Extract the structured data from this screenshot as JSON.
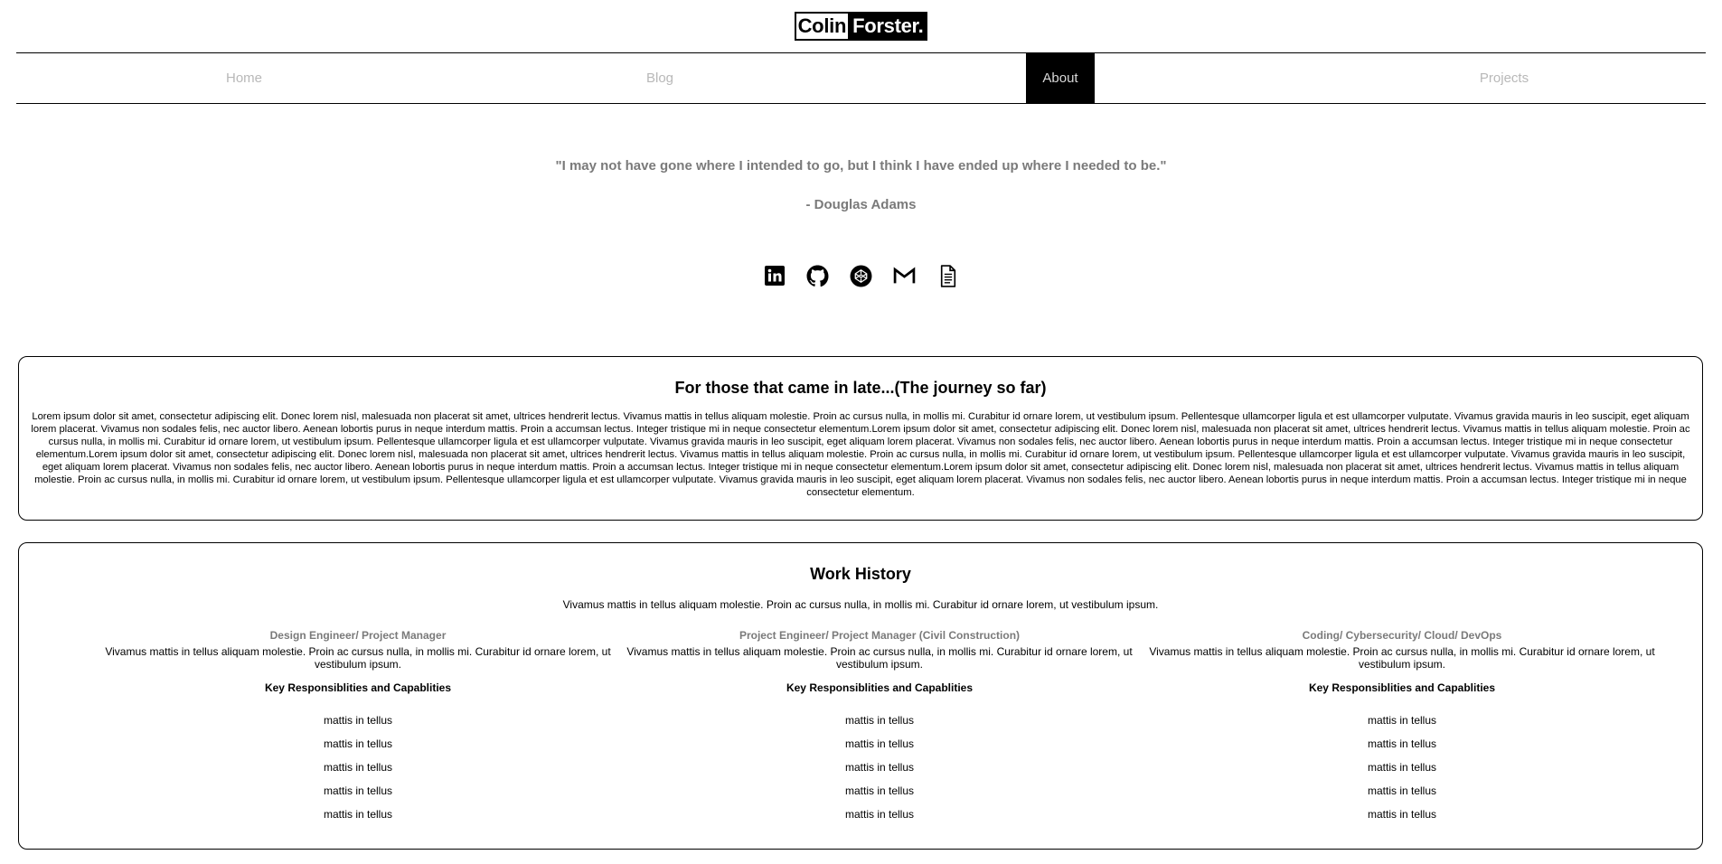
{
  "brand": {
    "first": "Colin",
    "last": "Forster."
  },
  "nav": [
    {
      "label": "Home",
      "active": false
    },
    {
      "label": "Blog",
      "active": false
    },
    {
      "label": "About",
      "active": true
    },
    {
      "label": "Projects",
      "active": false
    }
  ],
  "quote": {
    "text": "\"I may not have gone where I intended to go, but I think I have ended up where I needed to be.\"",
    "author": "- Douglas Adams"
  },
  "socials": [
    "linkedin-icon",
    "github-icon",
    "codepen-icon",
    "gmail-icon",
    "resume-document-icon"
  ],
  "journey": {
    "title": "For those that came in late...(The journey so far)",
    "text": "Lorem ipsum dolor sit amet, consectetur adipiscing elit. Donec lorem nisl, malesuada non placerat sit amet, ultrices hendrerit lectus. Vivamus mattis in tellus aliquam molestie. Proin ac cursus nulla, in mollis mi. Curabitur id ornare lorem, ut vestibulum ipsum. Pellentesque ullamcorper ligula et est ullamcorper vulputate. Vivamus gravida mauris in leo suscipit, eget aliquam lorem placerat. Vivamus non sodales felis, nec auctor libero. Aenean lobortis purus in neque interdum mattis. Proin a accumsan lectus. Integer tristique mi in neque consectetur elementum.Lorem ipsum dolor sit amet, consectetur adipiscing elit. Donec lorem nisl, malesuada non placerat sit amet, ultrices hendrerit lectus. Vivamus mattis in tellus aliquam molestie. Proin ac cursus nulla, in mollis mi. Curabitur id ornare lorem, ut vestibulum ipsum. Pellentesque ullamcorper ligula et est ullamcorper vulputate. Vivamus gravida mauris in leo suscipit, eget aliquam lorem placerat. Vivamus non sodales felis, nec auctor libero. Aenean lobortis purus in neque interdum mattis. Proin a accumsan lectus. Integer tristique mi in neque consectetur elementum.Lorem ipsum dolor sit amet, consectetur adipiscing elit. Donec lorem nisl, malesuada non placerat sit amet, ultrices hendrerit lectus. Vivamus mattis in tellus aliquam molestie. Proin ac cursus nulla, in mollis mi. Curabitur id ornare lorem, ut vestibulum ipsum. Pellentesque ullamcorper ligula et est ullamcorper vulputate. Vivamus gravida mauris in leo suscipit, eget aliquam lorem placerat. Vivamus non sodales felis, nec auctor libero. Aenean lobortis purus in neque interdum mattis. Proin a accumsan lectus. Integer tristique mi in neque consectetur elementum.Lorem ipsum dolor sit amet, consectetur adipiscing elit. Donec lorem nisl, malesuada non placerat sit amet, ultrices hendrerit lectus. Vivamus mattis in tellus aliquam molestie. Proin ac cursus nulla, in mollis mi. Curabitur id ornare lorem, ut vestibulum ipsum. Pellentesque ullamcorper ligula et est ullamcorper vulputate. Vivamus gravida mauris in leo suscipit, eget aliquam lorem placerat. Vivamus non sodales felis, nec auctor libero. Aenean lobortis purus in neque interdum mattis. Proin a accumsan lectus. Integer tristique mi in neque consectetur elementum."
  },
  "work": {
    "title": "Work History",
    "intro": "Vivamus mattis in tellus aliquam molestie. Proin ac cursus nulla, in mollis mi. Curabitur id ornare lorem, ut vestibulum ipsum.",
    "columns": [
      {
        "title": "Design Engineer/ Project Manager",
        "desc": "Vivamus mattis in tellus aliquam molestie. Proin ac cursus nulla, in mollis mi. Curabitur id ornare lorem, ut vestibulum ipsum.",
        "key": "Key Responsiblities and Capablities",
        "items": [
          "mattis in tellus",
          "mattis in tellus",
          "mattis in tellus",
          "mattis in tellus",
          "mattis in tellus"
        ]
      },
      {
        "title": "Project Engineer/ Project Manager (Civil Construction)",
        "desc": "Vivamus mattis in tellus aliquam molestie. Proin ac cursus nulla, in mollis mi. Curabitur id ornare lorem, ut vestibulum ipsum.",
        "key": "Key Responsiblities and Capablities",
        "items": [
          "mattis in tellus",
          "mattis in tellus",
          "mattis in tellus",
          "mattis in tellus",
          "mattis in tellus"
        ]
      },
      {
        "title": "Coding/ Cybersecurity/ Cloud/ DevOps",
        "desc": "Vivamus mattis in tellus aliquam molestie. Proin ac cursus nulla, in mollis mi. Curabitur id ornare lorem, ut vestibulum ipsum.",
        "key": "Key Responsiblities and Capablities",
        "items": [
          "mattis in tellus",
          "mattis in tellus",
          "mattis in tellus",
          "mattis in tellus",
          "mattis in tellus"
        ]
      }
    ]
  }
}
